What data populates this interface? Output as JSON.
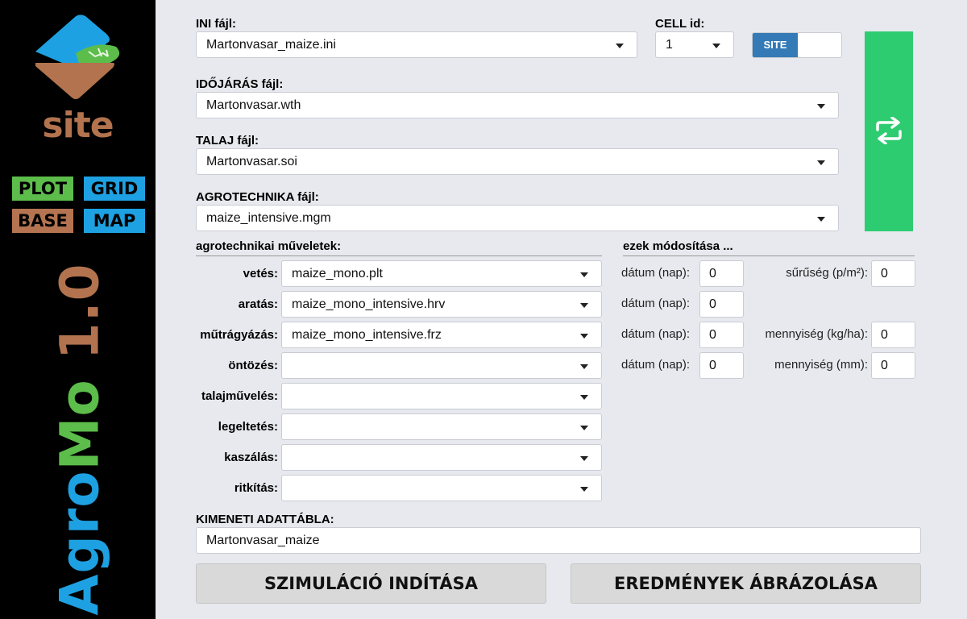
{
  "sidebar": {
    "logo_text": "site",
    "modes": {
      "plot": "PLOT",
      "grid": "GRID",
      "base": "BASE",
      "map": "MAP"
    },
    "title": {
      "part1": "Agro",
      "part2": "Mo",
      "part3": " 1.0"
    },
    "colors": {
      "blue": "#1ea1e2",
      "green": "#5cbd4b",
      "brown": "#b2734e"
    }
  },
  "form": {
    "ini": {
      "label": "INI fájl:",
      "value": "Martonvasar_maize.ini"
    },
    "cell": {
      "label": "CELL id:",
      "value": "1"
    },
    "site_toggle": {
      "label": "SITE"
    },
    "weather": {
      "label": "IDŐJÁRÁS fájl:",
      "value": "Martonvasar.wth"
    },
    "soil": {
      "label": "TALAJ fájl:",
      "value": "Martonvasar.soi"
    },
    "agrotech": {
      "label": "AGROTECHNIKA fájl:",
      "value": "maize_intensive.mgm"
    }
  },
  "operations": {
    "header": "agrotechnikai műveletek:",
    "rows": [
      {
        "label": "vetés:",
        "value": "maize_mono.plt"
      },
      {
        "label": "aratás:",
        "value": "maize_mono_intensive.hrv"
      },
      {
        "label": "műtrágyázás:",
        "value": "maize_mono_intensive.frz"
      },
      {
        "label": "öntözés:",
        "value": ""
      },
      {
        "label": "talajművelés:",
        "value": ""
      },
      {
        "label": "legeltetés:",
        "value": ""
      },
      {
        "label": "kaszálás:",
        "value": ""
      },
      {
        "label": "ritkítás:",
        "value": ""
      }
    ]
  },
  "modifications": {
    "header": "ezek módosítása ...",
    "date_label": "dátum (nap):",
    "dates": [
      "0",
      "0",
      "0",
      "0"
    ],
    "density": {
      "label": "sűrűség (p/m²):",
      "value": "0"
    },
    "fert_amount": {
      "label": "mennyiség (kg/ha):",
      "value": "0"
    },
    "irr_amount": {
      "label": "mennyiség (mm):",
      "value": "0"
    }
  },
  "output": {
    "label": "KIMENETI ADATTÁBLA:",
    "value": "Martonvasar_maize"
  },
  "actions": {
    "run": "SZIMULÁCIÓ INDÍTÁSA",
    "plot": "EREDMÉNYEK ÁBRÁZOLÁSA"
  },
  "accent": {
    "refresh": "#2ecc71",
    "toggle": "#337ab7"
  }
}
